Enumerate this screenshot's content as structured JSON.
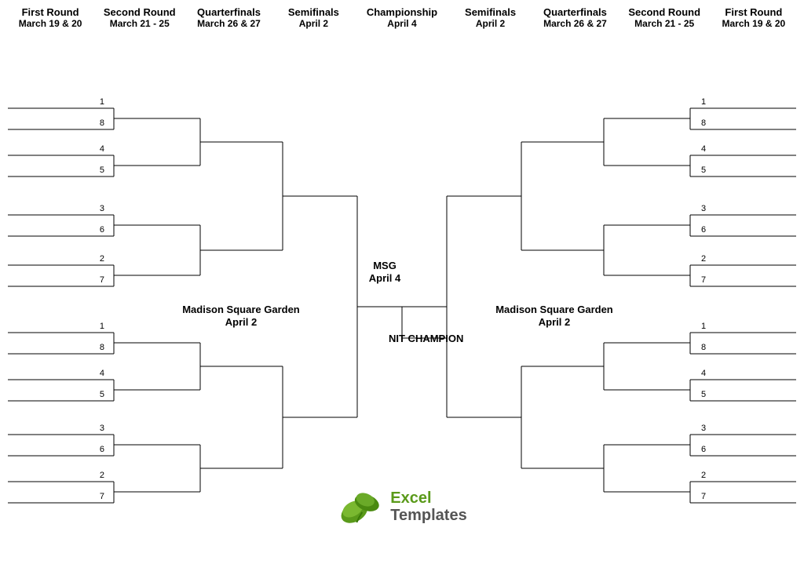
{
  "header": {
    "rounds": [
      {
        "name": "First Round",
        "date": "March 19 & 20"
      },
      {
        "name": "Second Round",
        "date": "March 21 - 25"
      },
      {
        "name": "Quarterfinals",
        "date": "March 26 & 27"
      },
      {
        "name": "Semifinals",
        "date": "April 2"
      },
      {
        "name": "Championship",
        "date": "April 4"
      },
      {
        "name": "Semifinals",
        "date": "April 2"
      },
      {
        "name": "Quarterfinals",
        "date": "March 26 & 27"
      },
      {
        "name": "Second Round",
        "date": "March 21 - 25"
      },
      {
        "name": "First Round",
        "date": "March 19 & 20"
      }
    ]
  },
  "bracket": {
    "left_venue": "Madison Square Garden\nApril 2",
    "right_venue": "Madison Square Garden\nApril 2",
    "championship_venue": "MSG\nApril 4",
    "champion_label": "NIT CHAMPION"
  },
  "logo": {
    "line1": "Excel",
    "line2": "Templates"
  }
}
